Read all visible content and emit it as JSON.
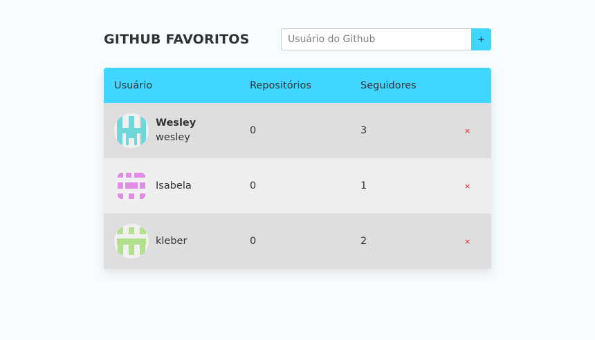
{
  "header": {
    "title": "GITHUB FAVORITOS",
    "search_placeholder": "Usuário do Github",
    "add_label": "+"
  },
  "table": {
    "columns": [
      "Usuário",
      "Repositórios",
      "Seguidores",
      ""
    ],
    "rows": [
      {
        "name": "Wesley",
        "login": "wesley",
        "repositories": "0",
        "followers": "3",
        "avatar_color": "#6fd6d9",
        "avatar_icon": "identicon-avatar",
        "remove_label": "×"
      },
      {
        "name": "",
        "login": "Isabela",
        "repositories": "0",
        "followers": "1",
        "avatar_color": "#e08ce6",
        "avatar_icon": "identicon-avatar",
        "remove_label": "×"
      },
      {
        "name": "",
        "login": "kleber",
        "repositories": "0",
        "followers": "2",
        "avatar_color": "#b3e08c",
        "avatar_icon": "identicon-avatar",
        "remove_label": "×"
      }
    ]
  },
  "colors": {
    "accent": "#40d6ff",
    "remove": "#e61919",
    "row_dark": "#dedede",
    "row_light": "#eeeeee"
  }
}
